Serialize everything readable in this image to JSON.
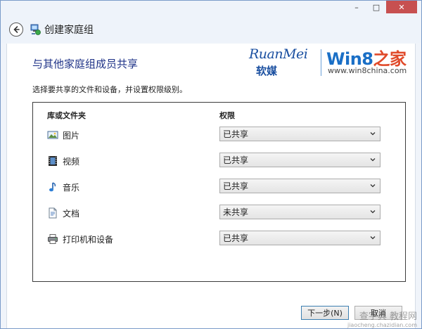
{
  "window": {
    "title": "创建家庭组",
    "controls": {
      "minimize": "–",
      "maximize": "□",
      "close": "✕"
    }
  },
  "page": {
    "heading": "与其他家庭组成员共享",
    "subtext": "选择要共享的文件和设备，并设置权限级别。"
  },
  "logo": {
    "ruanmei_en": "RuanMei",
    "ruanmei_cn": "软媒",
    "win8_main": "Win8",
    "win8_accent": "之家",
    "win8_url": "www.win8china.com"
  },
  "table": {
    "col_library": "库或文件夹",
    "col_permission": "权限",
    "rows": [
      {
        "label": "图片",
        "icon": "pictures-icon",
        "permission": "已共享"
      },
      {
        "label": "视频",
        "icon": "videos-icon",
        "permission": "已共享"
      },
      {
        "label": "音乐",
        "icon": "music-icon",
        "permission": "已共享"
      },
      {
        "label": "文档",
        "icon": "documents-icon",
        "permission": "未共享"
      },
      {
        "label": "打印机和设备",
        "icon": "printer-icon",
        "permission": "已共享"
      }
    ]
  },
  "buttons": {
    "next": "下一步(N)",
    "cancel": "取消"
  },
  "watermark": {
    "text": "查字典 教程网",
    "url": "jiaocheng.chazidian.com"
  },
  "colors": {
    "heading": "#1e3287",
    "close_button": "#c75050",
    "brand_blue": "#1a6fc6",
    "brand_orange": "#e04a2a"
  }
}
